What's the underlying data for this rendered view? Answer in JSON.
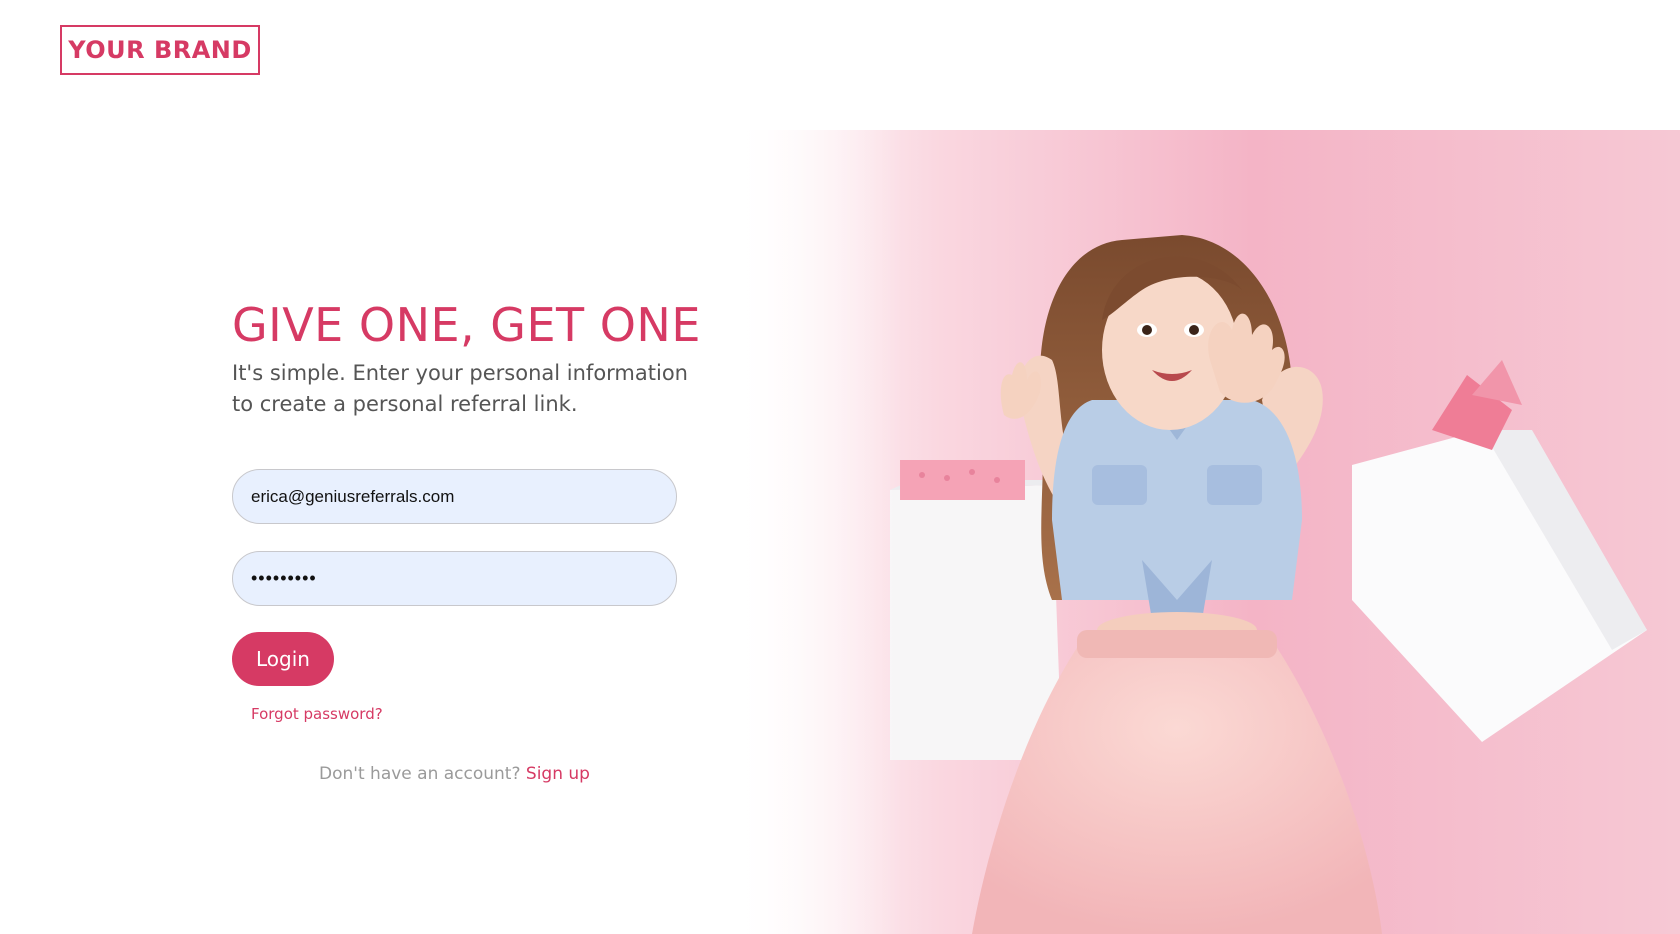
{
  "brand": {
    "logo_text": "YOUR BRAND"
  },
  "hero": {
    "headline": "GIVE ONE, GET ONE",
    "subtext": "It's simple. Enter your personal information to create a personal referral link."
  },
  "form": {
    "email_value": "erica@geniusreferrals.com",
    "password_value": "•••••••••",
    "login_label": "Login",
    "forgot_label": "Forgot password?"
  },
  "signup": {
    "prompt": "Don't have an account?",
    "link_label": "Sign up"
  },
  "colors": {
    "accent": "#d63a64",
    "input_bg": "#e8f0fe",
    "muted_text": "#9a9a9a",
    "body_text": "#555555"
  },
  "icons": {
    "hero_image": "girl-with-shopping-bags-illustration"
  }
}
